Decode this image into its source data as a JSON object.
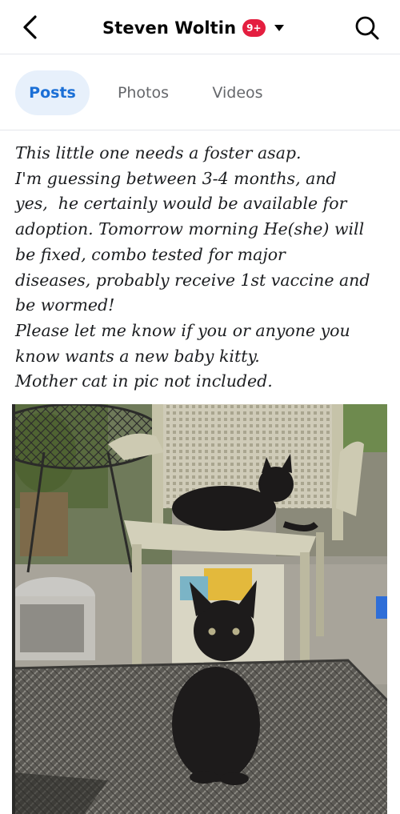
{
  "header": {
    "title": "Steven Woltin",
    "badge": "9+",
    "icons": {
      "back": "back-arrow-icon",
      "caret": "caret-down-icon",
      "search": "search-icon"
    }
  },
  "tabs": [
    {
      "label": "Posts",
      "active": true
    },
    {
      "label": "Photos",
      "active": false
    },
    {
      "label": "Videos",
      "active": false
    }
  ],
  "post": {
    "text": "This little one needs a foster asap.\nI'm guessing between 3-4 months, and\nyes,  he certainly would be available for\nadoption. Tomorrow morning He(she) will\nbe fixed, combo tested for major\ndiseases, probably receive 1st vaccine and\nbe wormed!\nPlease let me know if you or anyone you\nknow wants a new baby kitty.\nMother cat in pic not included."
  },
  "colors": {
    "accent": "#1b6fd6",
    "active_tab_bg": "#e7f0fb",
    "badge_bg": "#e41e3f"
  }
}
